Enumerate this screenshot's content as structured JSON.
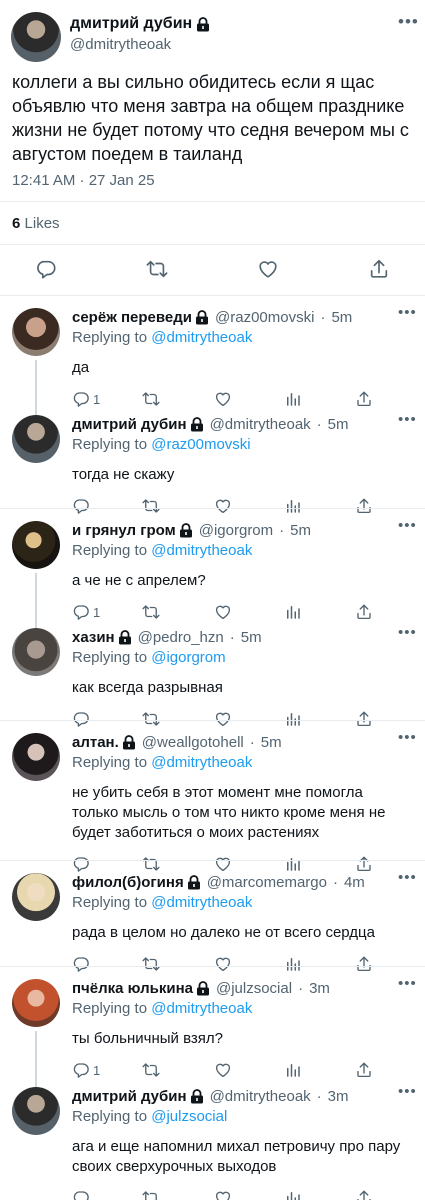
{
  "main_tweet": {
    "author_name": "дмитрий дубин",
    "author_handle": "@dmitrytheoak",
    "text": "коллеги а вы сильно обидитесь если я щас объявлю что меня завтра на общем празднике жизни не будет потому что седня вечером мы с августом поедем в таиланд",
    "timestamp": "12:41 AM · 27 Jan 25",
    "likes_count": "6",
    "likes_label": "Likes",
    "more_label": "•••"
  },
  "replies": [
    {
      "name": "серёж переведи",
      "handle": "@raz00movski",
      "time": "5m",
      "replying_label": "Replying to",
      "replying_to": "@dmitrytheoak",
      "text": "да",
      "reply_count": "1"
    },
    {
      "name": "дмитрий дубин",
      "handle": "@dmitrytheoak",
      "time": "5m",
      "replying_label": "Replying to",
      "replying_to": "@raz00movski",
      "text": "тогда не скажу",
      "reply_count": ""
    },
    {
      "name": "и грянул гром",
      "handle": "@igorgrom",
      "time": "5m",
      "replying_label": "Replying to",
      "replying_to": "@dmitrytheoak",
      "text": "а че не с апрелем?",
      "reply_count": "1"
    },
    {
      "name": "хазин",
      "handle": "@pedro_hzn",
      "time": "5m",
      "replying_label": "Replying to",
      "replying_to": "@igorgrom",
      "text": "как всегда разрывная",
      "reply_count": ""
    },
    {
      "name": "алтан.",
      "handle": "@weallgotohell",
      "time": "5m",
      "replying_label": "Replying to",
      "replying_to": "@dmitrytheoak",
      "text": "не убить себя в этот момент мне помогла только мысль о том что никто кроме меня не будет заботиться о моих растениях",
      "reply_count": ""
    },
    {
      "name": "филол(б)огиня",
      "handle": "@marcomemargo",
      "time": "4m",
      "replying_label": "Replying to",
      "replying_to": "@dmitrytheoak",
      "text": "рада в целом но далеко не от всего сердца",
      "reply_count": ""
    },
    {
      "name": "пчёлка юлькина",
      "handle": "@julzsocial",
      "time": "3m",
      "replying_label": "Replying to",
      "replying_to": "@dmitrytheoak",
      "text": "ты больничный взял?",
      "reply_count": "1"
    },
    {
      "name": "дмитрий дубин",
      "handle": "@dmitrytheoak",
      "time": "3m",
      "replying_label": "Replying to",
      "replying_to": "@julzsocial",
      "text": "ага и еще напомнил михал петровичу про пару своих сверхурочных выходов",
      "reply_count": ""
    }
  ],
  "icons": {
    "lock": "lock-icon",
    "reply": "reply-icon",
    "retweet": "retweet-icon",
    "like": "heart-icon",
    "analytics": "analytics-icon",
    "share": "share-icon"
  },
  "colors": {
    "text": "#0f1419",
    "secondary": "#536471",
    "link": "#1d9bf0",
    "divider": "#e6ecf0"
  }
}
